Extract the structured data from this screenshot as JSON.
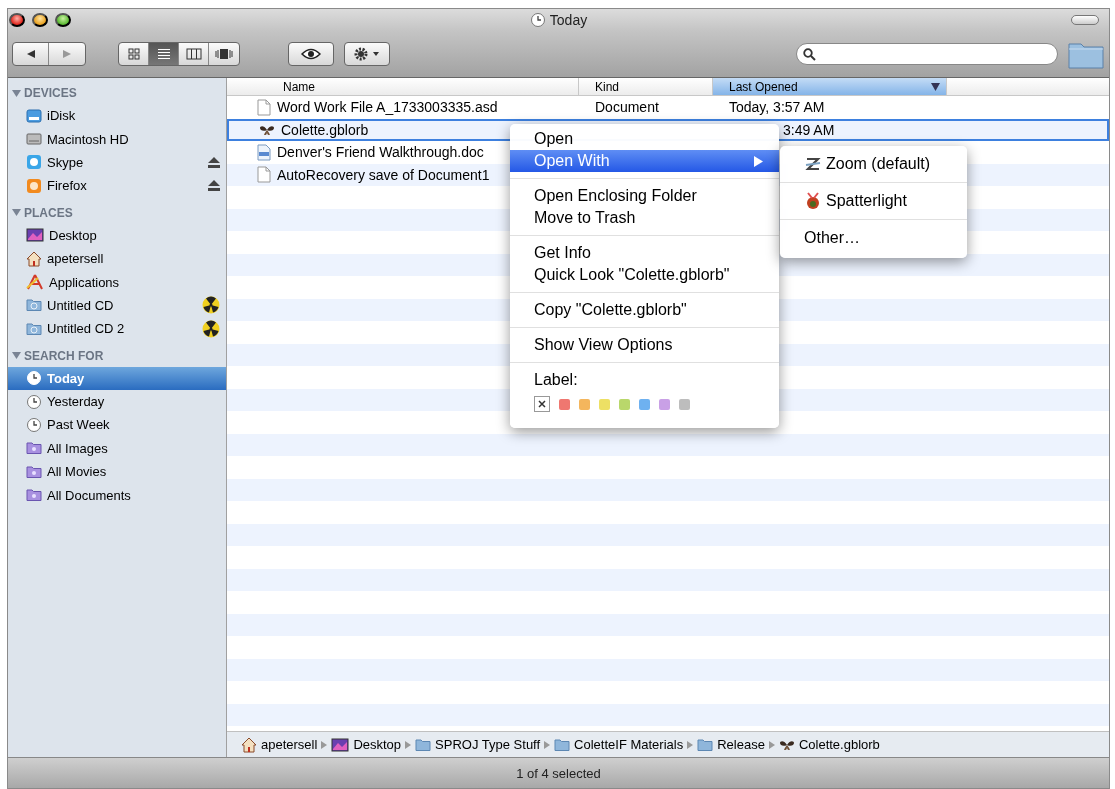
{
  "window": {
    "title": "Today"
  },
  "toolbar": {
    "view_modes": [
      {
        "kind": "icons",
        "selected": false
      },
      {
        "kind": "list",
        "selected": true
      },
      {
        "kind": "columns",
        "selected": false
      },
      {
        "kind": "coverflow",
        "selected": false
      }
    ]
  },
  "sidebar": {
    "sections": [
      {
        "title": "DEVICES",
        "expanded": true,
        "items": [
          {
            "label": "iDisk",
            "kind": "idisk",
            "selected": false
          },
          {
            "label": "Macintosh HD",
            "kind": "drive",
            "selected": false
          },
          {
            "label": "Skype",
            "kind": "skype",
            "selected": false,
            "eject": true
          },
          {
            "label": "Firefox",
            "kind": "firefox",
            "selected": false,
            "eject": true
          }
        ]
      },
      {
        "title": "PLACES",
        "expanded": true,
        "items": [
          {
            "label": "Desktop",
            "kind": "desktop",
            "selected": false
          },
          {
            "label": "apetersell",
            "kind": "home",
            "selected": false
          },
          {
            "label": "Applications",
            "kind": "apps",
            "selected": false
          },
          {
            "label": "Untitled CD",
            "kind": "cd",
            "selected": false,
            "burn": true
          },
          {
            "label": "Untitled CD 2",
            "kind": "cd",
            "selected": false,
            "burn": true
          }
        ]
      },
      {
        "title": "SEARCH FOR",
        "expanded": true,
        "items": [
          {
            "label": "Today",
            "kind": "clock",
            "selected": true
          },
          {
            "label": "Yesterday",
            "kind": "clock",
            "selected": false
          },
          {
            "label": "Past Week",
            "kind": "clock",
            "selected": false
          },
          {
            "label": "All Images",
            "kind": "smart",
            "selected": false
          },
          {
            "label": "All Movies",
            "kind": "smart",
            "selected": false
          },
          {
            "label": "All Documents",
            "kind": "smart",
            "selected": false
          }
        ]
      }
    ]
  },
  "table": {
    "columns": [
      {
        "label": "Name",
        "sorted": false
      },
      {
        "label": "Kind",
        "sorted": false
      },
      {
        "label": "Last Opened",
        "sorted": true
      }
    ],
    "rows": [
      {
        "name": "Word Work File A_1733003335.asd",
        "file_kind": "Document",
        "last_opened": "Today, 3:57 AM",
        "kind": "doc",
        "selected": false
      },
      {
        "name": "Colette.gblorb",
        "last_opened": "3:49 AM",
        "kind": "game",
        "selected": true
      },
      {
        "name": "Denver's Friend Walkthrough.doc",
        "kind": "docx",
        "selected": false
      },
      {
        "name": "AutoRecovery save of Document1",
        "kind": "doc",
        "selected": false
      }
    ]
  },
  "path_bar": [
    {
      "label": "apetersell",
      "kind": "home"
    },
    {
      "label": "Desktop",
      "kind": "desktop"
    },
    {
      "label": "SPROJ Type Stuff",
      "kind": "folder"
    },
    {
      "label": "ColetteIF Materials",
      "kind": "folder"
    },
    {
      "label": "Release",
      "kind": "folder"
    },
    {
      "label": "Colette.gblorb",
      "kind": "butterfly"
    }
  ],
  "status_bar": "1 of 4 selected",
  "context_menu": {
    "items": [
      {
        "kind": "item",
        "label": "Open",
        "selected": false
      },
      {
        "kind": "item",
        "label": "Open With",
        "selected": true,
        "submenu": true
      },
      {
        "kind": "separator"
      },
      {
        "kind": "item",
        "label": "Open Enclosing Folder",
        "selected": false
      },
      {
        "kind": "item",
        "label": "Move to Trash",
        "selected": false
      },
      {
        "kind": "separator"
      },
      {
        "kind": "item",
        "label": "Get Info",
        "selected": false
      },
      {
        "kind": "item",
        "label": "Quick Look \"Colette.gblorb\"",
        "selected": false
      },
      {
        "kind": "separator"
      },
      {
        "kind": "item",
        "label": "Copy \"Colette.gblorb\"",
        "selected": false
      },
      {
        "kind": "separator"
      },
      {
        "kind": "item",
        "label": "Show View Options",
        "selected": false
      },
      {
        "kind": "separator"
      },
      {
        "kind": "labels",
        "label": "Label:",
        "colors": [
          {
            "color": "#ef7770"
          },
          {
            "color": "#f4b65d"
          },
          {
            "color": "#ede064"
          },
          {
            "color": "#b9d76b"
          },
          {
            "color": "#6eb1f0"
          },
          {
            "color": "#c9a0e6"
          },
          {
            "color": "#bdbdbd"
          }
        ]
      }
    ]
  },
  "submenu": {
    "items": [
      {
        "kind": "app",
        "label": "Zoom (default)",
        "selected": false
      },
      {
        "kind": "separator"
      },
      {
        "kind": "app",
        "label": "Spatterlight",
        "selected": false
      },
      {
        "kind": "separator"
      },
      {
        "kind": "app",
        "label": "Other…",
        "selected": false
      }
    ]
  }
}
